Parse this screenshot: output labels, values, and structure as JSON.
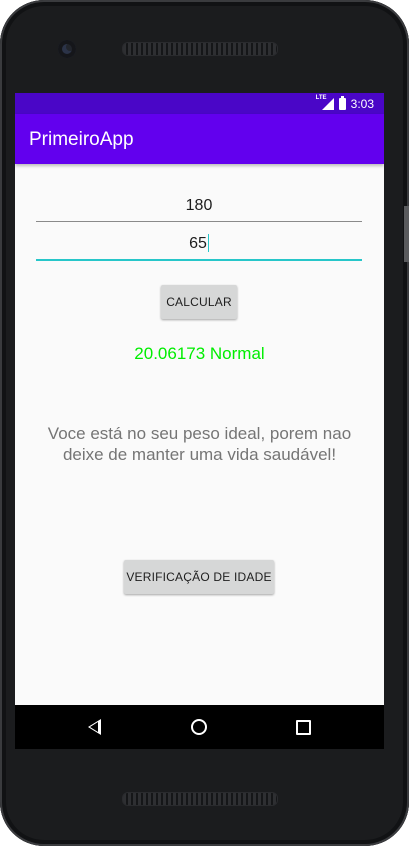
{
  "status_bar": {
    "network_icon": "lte-signal-icon",
    "network_label": "LTE",
    "battery_icon": "battery-charging-icon",
    "time": "3:03"
  },
  "app_bar": {
    "title": "PrimeiroApp"
  },
  "form": {
    "height_value": "180",
    "weight_value": "65",
    "calculate_label": "CALCULAR"
  },
  "result": {
    "text": "20.06173 Normal",
    "color": "#00ee00"
  },
  "message": "Voce está no seu peso ideal, porem nao deixe de manter uma vida saudável!",
  "age_button_label": "VERIFICAÇÃO DE IDADE",
  "nav_bar": {
    "back_icon": "back-icon",
    "home_icon": "home-icon",
    "recents_icon": "recents-icon"
  },
  "colors": {
    "primary": "#6200ee",
    "primary_dark": "#4a06c7",
    "accent": "#26c6c9"
  }
}
